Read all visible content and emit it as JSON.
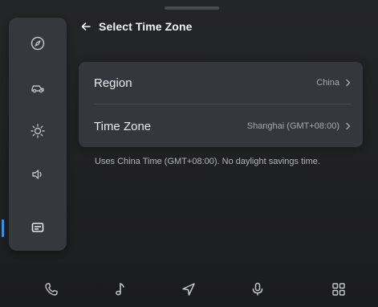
{
  "header": {
    "back_icon": "back-arrow-icon",
    "title": "Select Time Zone"
  },
  "side_rail": {
    "items": [
      {
        "name": "rail-item-compass",
        "icon": "compass-icon"
      },
      {
        "name": "rail-item-car",
        "icon": "car-icon"
      },
      {
        "name": "rail-item-display",
        "icon": "brightness-icon"
      },
      {
        "name": "rail-item-sound",
        "icon": "speaker-icon"
      },
      {
        "name": "rail-item-system",
        "icon": "system-card-icon",
        "active": true
      }
    ]
  },
  "settings": {
    "rows": [
      {
        "label": "Region",
        "value": "China"
      },
      {
        "label": "Time Zone",
        "value": "Shanghai (GMT+08:00)"
      }
    ],
    "note": "Uses China Time (GMT+08:00). No daylight savings time."
  },
  "dock": {
    "items": [
      {
        "name": "dock-phone",
        "icon": "phone-icon"
      },
      {
        "name": "dock-music",
        "icon": "music-note-icon"
      },
      {
        "name": "dock-navigation",
        "icon": "navigation-icon"
      },
      {
        "name": "dock-voice",
        "icon": "microphone-icon"
      },
      {
        "name": "dock-apps",
        "icon": "apps-grid-icon"
      }
    ]
  },
  "colors": {
    "accent": "#3b8ee8",
    "card": "#34383c",
    "rail": "#35393d",
    "background": "#1f2022"
  }
}
